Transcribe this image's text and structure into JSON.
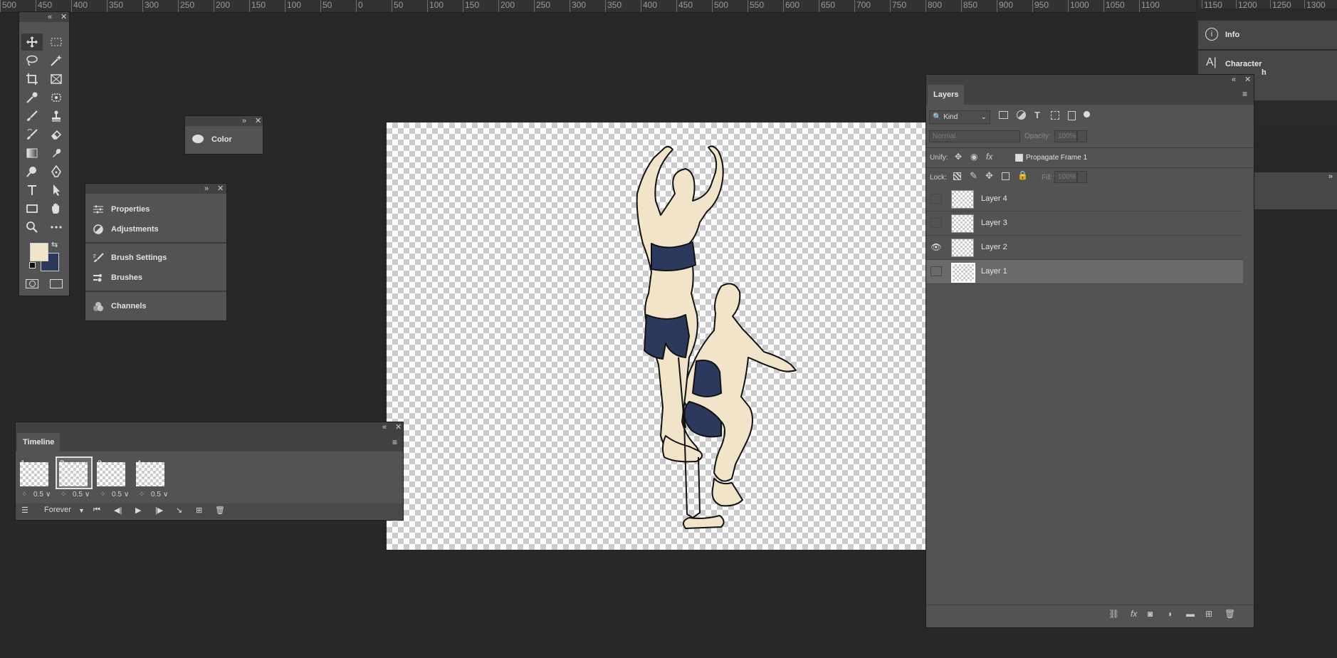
{
  "ruler": {
    "ticks": [
      "500",
      "450",
      "400",
      "350",
      "300",
      "250",
      "200",
      "150",
      "100",
      "50",
      "0",
      "50",
      "100",
      "150",
      "200",
      "250",
      "300",
      "350",
      "400",
      "450",
      "500",
      "550",
      "600",
      "650",
      "700",
      "750",
      "800",
      "850",
      "900",
      "950",
      "1000",
      "1050",
      "1100"
    ],
    "ticks_right": [
      "1150",
      "1200",
      "1250",
      "1300"
    ]
  },
  "right_dock": {
    "info_label": "Info",
    "character_label": "Character",
    "hidden_label_fragment": "h"
  },
  "toolbar": {
    "foreground_color": "#f2e4c8",
    "background_color": "#2b3a5c",
    "tools": [
      "move-tool",
      "marquee-tool",
      "lasso-tool",
      "magic-wand-tool",
      "crop-tool",
      "frame-tool",
      "eyedropper-tool",
      "patch-tool",
      "brush-tool",
      "stamp-tool",
      "history-brush-tool",
      "eraser-tool",
      "gradient-tool",
      "smudge-tool",
      "dodge-tool",
      "pen-tool",
      "type-tool",
      "path-select-tool",
      "rectangle-tool",
      "hand-tool",
      "zoom-tool",
      "more-tools"
    ]
  },
  "color_panel": {
    "label": "Color"
  },
  "panel_group": {
    "items": [
      {
        "label": "Properties",
        "icon": "sliders-icon"
      },
      {
        "label": "Adjustments",
        "icon": "adjustments-icon"
      },
      {
        "label": "Brush Settings",
        "icon": "brush-settings-icon"
      },
      {
        "label": "Brushes",
        "icon": "brushes-icon"
      },
      {
        "label": "Channels",
        "icon": "channels-icon"
      }
    ]
  },
  "timeline": {
    "tab_label": "Timeline",
    "frames": [
      {
        "number": "1",
        "delay": "0.5"
      },
      {
        "number": "2",
        "delay": "0.5",
        "selected": true
      },
      {
        "number": "3",
        "delay": "0.5"
      },
      {
        "number": "4",
        "delay": "0.5"
      }
    ],
    "loop_option": "Forever"
  },
  "layers": {
    "tab_label": "Layers",
    "filter_kind": "Kind",
    "blend_mode": "Normal",
    "opacity_label": "Opacity:",
    "opacity_value": "100%",
    "unify_label": "Unify:",
    "propagate_label": "Propagate Frame 1",
    "lock_label": "Lock:",
    "fill_label": "Fill:",
    "fill_value": "100%",
    "rows": [
      {
        "name": "Layer 4",
        "visible": false,
        "selected": false
      },
      {
        "name": "Layer 3",
        "visible": false,
        "selected": false
      },
      {
        "name": "Layer 2",
        "visible": true,
        "selected": false
      },
      {
        "name": "Layer 1",
        "visible": false,
        "selected": true
      }
    ]
  },
  "artwork": {
    "skin_color": "#f2e4c8",
    "clothing_color": "#2b3a5c",
    "outline_color": "#111111"
  }
}
